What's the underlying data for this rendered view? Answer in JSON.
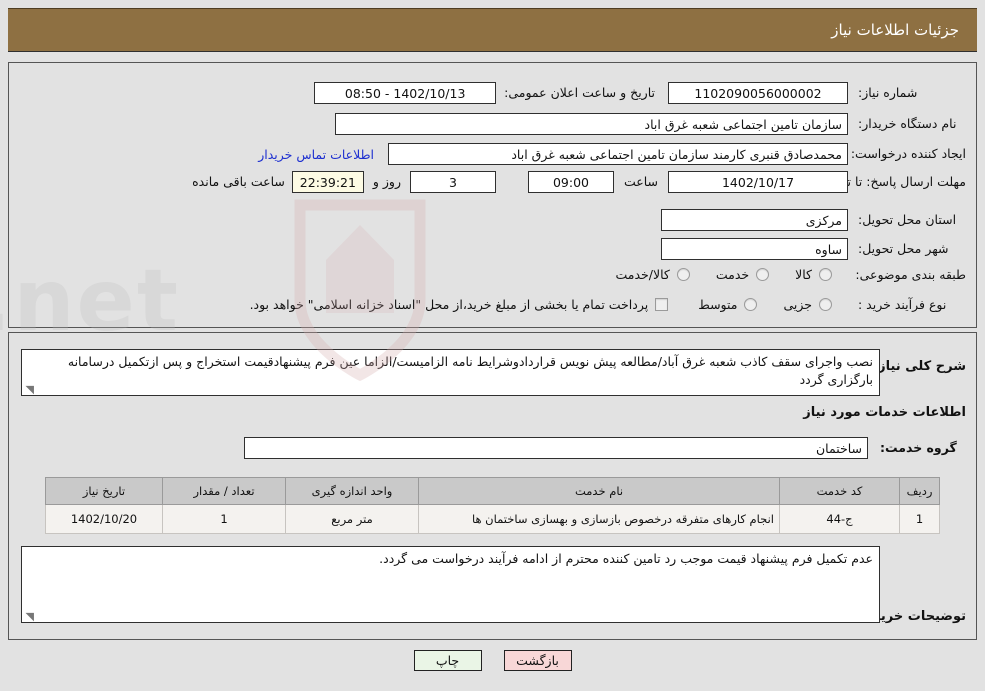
{
  "header": {
    "title": "جزئیات اطلاعات نیاز"
  },
  "fields": {
    "need_number_label": "شماره نیاز:",
    "need_number_value": "1102090056000002",
    "public_announce_label": "تاریخ و ساعت اعلان عمومی:",
    "public_announce_value": "1402/10/13 - 08:50",
    "buyer_org_label": "نام دستگاه خریدار:",
    "buyer_org_value": "سازمان تامین اجتماعی شعبه غرق اباد",
    "creator_label": "ایجاد کننده درخواست:",
    "creator_value": "محمدصادق قنبری کارمند سازمان تامین اجتماعی شعبه غرق اباد",
    "contact_link": "اطلاعات تماس خریدار",
    "deadline_label": "مهلت ارسال پاسخ: تا تاریخ:",
    "deadline_date": "1402/10/17",
    "deadline_hour_label": "ساعت",
    "deadline_hour_value": "09:00",
    "remaining_days_value": "3",
    "remaining_days_label": "روز و",
    "remaining_time_value": "22:39:21",
    "remaining_time_label": "ساعت باقی مانده",
    "province_label": "استان محل تحویل:",
    "province_value": "مرکزی",
    "city_label": "شهر محل تحویل:",
    "city_value": "ساوه"
  },
  "classification": {
    "label": "طبقه بندی موضوعی:",
    "options": [
      {
        "label": "کالا",
        "selected": false
      },
      {
        "label": "خدمت",
        "selected": false
      },
      {
        "label": "کالا/خدمت",
        "selected": false
      }
    ]
  },
  "purchase_process": {
    "label": "نوع فرآیند خرید :",
    "options": [
      {
        "label": "جزیی",
        "selected": false
      },
      {
        "label": "متوسط",
        "selected": false
      }
    ],
    "treasury_note": "پرداخت تمام یا بخشی از مبلغ خرید،از محل \"اسناد خزانه اسلامی\" خواهد بود.",
    "treasury_checked": false
  },
  "general_description": {
    "label": "شرح کلی نیاز:",
    "value": "نصب واجرای سقف کاذب شعبه غرق آباد/مطالعه پیش نویس قراردادوشرایط نامه الزامیست/الزاما عین فرم پیشنهادقیمت استخراج و پس ازتکمیل درسامانه بارگزاری گردد"
  },
  "services_section": {
    "heading": "اطلاعات خدمات مورد نیاز",
    "group_label": "گروه خدمت:",
    "group_value": "ساختمان"
  },
  "table": {
    "columns": [
      "ردیف",
      "کد خدمت",
      "نام خدمت",
      "واحد اندازه گیری",
      "تعداد / مقدار",
      "تاریخ نیاز"
    ],
    "rows": [
      {
        "row_no": "1",
        "service_code": "ج-44",
        "service_name": "انجام کارهای متفرقه درخصوص بازسازی و بهسازی ساختمان ها",
        "unit": "متر مربع",
        "quantity": "1",
        "need_date": "1402/10/20"
      }
    ]
  },
  "buyer_comments": {
    "label": "توضیحات خریدار:",
    "value": "عدم تکمیل فرم پیشنهاد قیمت موجب رد تامین کننده محترم از ادامه فرآیند درخواست می گردد."
  },
  "footer": {
    "print_label": "چاپ",
    "back_label": "بازگشت"
  },
  "watermark": {
    "text": "AriaTender.net"
  },
  "colors": {
    "header_bg": "#8e7042",
    "page_bg": "#e2e2e2",
    "link": "#1d2fd0",
    "timer_bg": "#fdfbe4",
    "table_header_bg": "#c9c9c9",
    "btn_print_bg": "#eaf5e6",
    "btn_back_bg": "#f8d7d7"
  }
}
